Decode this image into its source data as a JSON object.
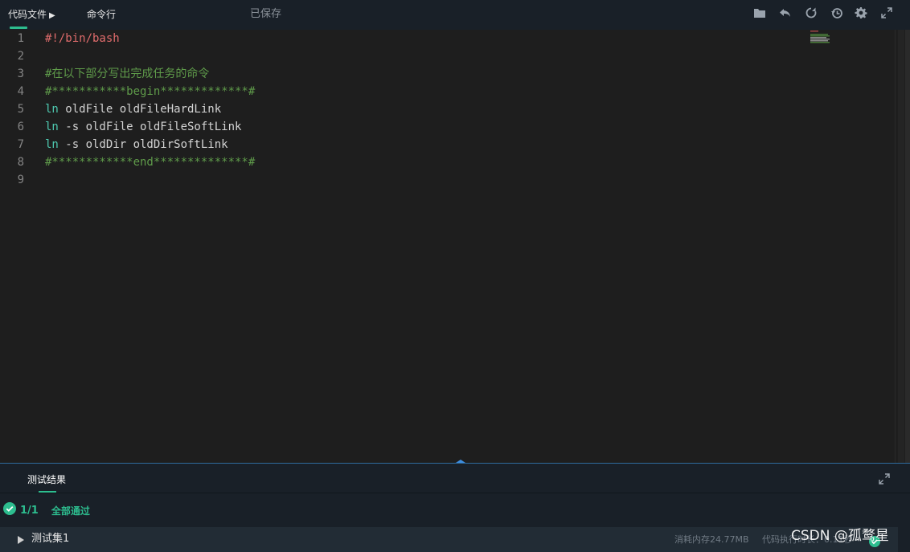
{
  "topbar": {
    "tab_code_file": "代码文件",
    "tab_command_line": "命令行",
    "saved_status": "已保存",
    "icons": [
      "folder-icon",
      "undo-icon",
      "refresh-icon",
      "history-icon",
      "gear-icon",
      "fullscreen-icon"
    ],
    "accent_color": "#2dbd8f"
  },
  "editor": {
    "lines": [
      {
        "number": "1",
        "segments": [
          {
            "text": "#!/bin/bash",
            "kind": "shebang"
          }
        ]
      },
      {
        "number": "2",
        "segments": []
      },
      {
        "number": "3",
        "segments": [
          {
            "text": "#在以下部分写出完成任务的命令",
            "kind": "comment"
          }
        ]
      },
      {
        "number": "4",
        "segments": [
          {
            "text": "#***********begin*************#",
            "kind": "comment"
          }
        ]
      },
      {
        "number": "5",
        "segments": [
          {
            "text": "ln",
            "kind": "cmd"
          },
          {
            "text": " oldFile oldFileHardLink",
            "kind": "text"
          }
        ]
      },
      {
        "number": "6",
        "segments": [
          {
            "text": "ln",
            "kind": "cmd"
          },
          {
            "text": " -s oldFile oldFileSoftLink",
            "kind": "text"
          }
        ]
      },
      {
        "number": "7",
        "segments": [
          {
            "text": "ln",
            "kind": "cmd"
          },
          {
            "text": " -s oldDir oldDirSoftLink",
            "kind": "text"
          }
        ]
      },
      {
        "number": "8",
        "segments": [
          {
            "text": "#************end**************#",
            "kind": "comment"
          }
        ]
      },
      {
        "number": "9",
        "segments": []
      }
    ],
    "colors": {
      "shebang": "#e06c6c",
      "comment": "#5f9b4a",
      "cmd": "#4ec9b0",
      "text": "#d4d4d4"
    }
  },
  "results": {
    "tab_label": "测试结果",
    "pass_count": "1/1",
    "pass_text": "全部通过",
    "testset_label": "测试集1",
    "memory": "消耗内存24.77MB",
    "exec_time": "代码执行时长：0.11秒"
  },
  "watermark": "CSDN @孤鹜星"
}
